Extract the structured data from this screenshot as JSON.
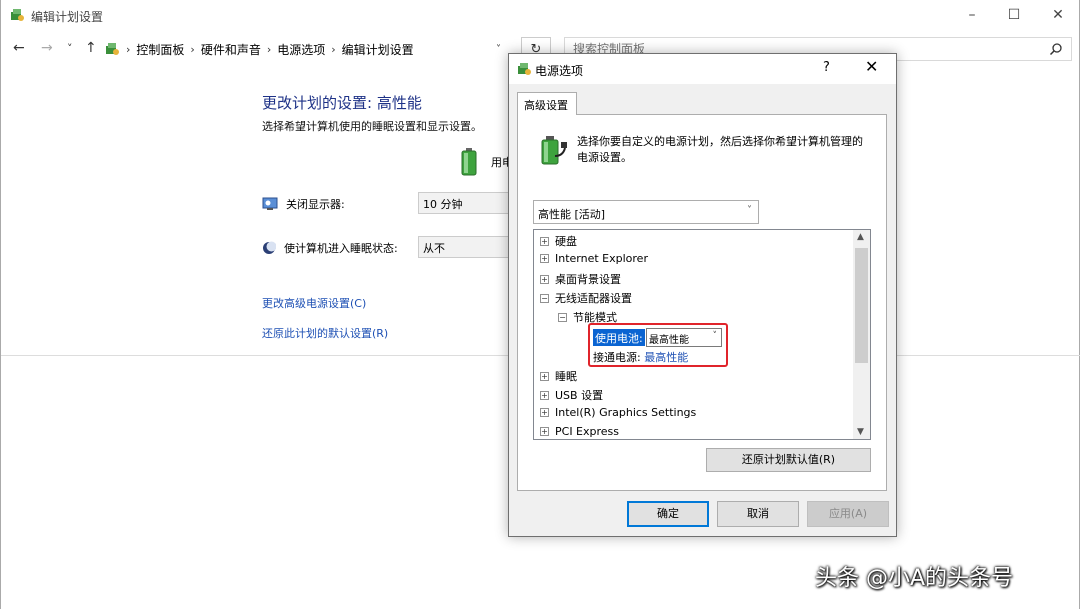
{
  "window": {
    "title": "编辑计划设置",
    "minimize": "–",
    "maximize": "☐",
    "close": "✕"
  },
  "nav": {
    "back": "←",
    "forward": "→",
    "recent": "˅",
    "up": "↑",
    "breadcrumbs": [
      "控制面板",
      "硬件和声音",
      "电源选项",
      "编辑计划设置"
    ],
    "separator": "›",
    "dropdown": "˅",
    "refresh": "↻",
    "search_placeholder": "搜索控制面板"
  },
  "main": {
    "heading": "更改计划的设置: 高性能",
    "subtitle": "选择希望计算机使用的睡眠设置和显示设置。",
    "column_label": "用电",
    "display_off_label": "关闭显示器:",
    "display_off_value": "10 分钟",
    "sleep_label": "使计算机进入睡眠状态:",
    "sleep_value": "从不",
    "link_advanced": "更改高级电源设置(C)",
    "link_restore": "还原此计划的默认设置(R)"
  },
  "dialog": {
    "title": "电源选项",
    "help": "?",
    "close": "✕",
    "tab": "高级设置",
    "description": "选择你要自定义的电源计划，然后选择你希望计算机管理的电源设置。",
    "plan_select": "高性能 [活动]",
    "tree": [
      {
        "sign": "+",
        "label": "硬盘"
      },
      {
        "sign": "+",
        "label": "Internet Explorer"
      },
      {
        "sign": "+",
        "label": "桌面背景设置"
      },
      {
        "sign": "−",
        "label": "无线适配器设置"
      },
      {
        "sign": "−",
        "label": "节能模式"
      },
      {
        "sign": "+",
        "label": "睡眠"
      },
      {
        "sign": "+",
        "label": "USB 设置"
      },
      {
        "sign": "+",
        "label": "Intel(R) Graphics Settings"
      },
      {
        "sign": "+",
        "label": "PCI Express"
      }
    ],
    "battery_label": "使用电池:",
    "battery_value": "最高性能",
    "ac_label": "接通电源:",
    "ac_value": "最高性能",
    "restore_button": "还原计划默认值(R)",
    "ok_button": "确定",
    "cancel_button": "取消",
    "apply_button": "应用(A)"
  },
  "watermark": "头条 @小A的头条号",
  "colors": {
    "link": "#1e50b4",
    "heading": "#1e3287",
    "highlight": "#0a64d2",
    "annotation": "#e0242b"
  }
}
